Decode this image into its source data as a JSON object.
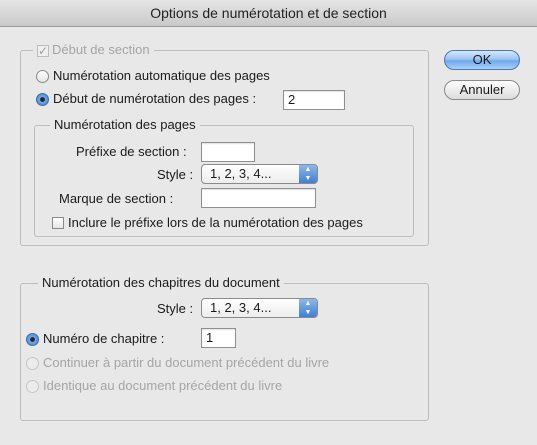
{
  "window": {
    "title": "Options de numérotation et de section"
  },
  "buttons": {
    "ok": "OK",
    "cancel": "Annuler"
  },
  "section": {
    "start_checkbox": "Début de section",
    "auto_radio": "Numérotation automatique des pages",
    "start_radio": "Début de numérotation des pages :",
    "start_value": "2",
    "page_numbering": {
      "legend": "Numérotation des pages",
      "prefix_label": "Préfixe de section :",
      "prefix_value": "",
      "style_label": "Style :",
      "style_value": "1, 2, 3, 4...",
      "marker_label": "Marque de section :",
      "marker_value": "",
      "include_prefix_label": "Inclure le préfixe lors de la numérotation des pages"
    }
  },
  "chapters": {
    "legend": "Numérotation des chapitres du document",
    "style_label": "Style :",
    "style_value": "1, 2, 3, 4...",
    "chapter_radio": "Numéro de chapitre :",
    "chapter_value": "1",
    "continue_radio": "Continuer à partir du document précédent du livre",
    "same_radio": "Identique au document précédent du livre"
  }
}
